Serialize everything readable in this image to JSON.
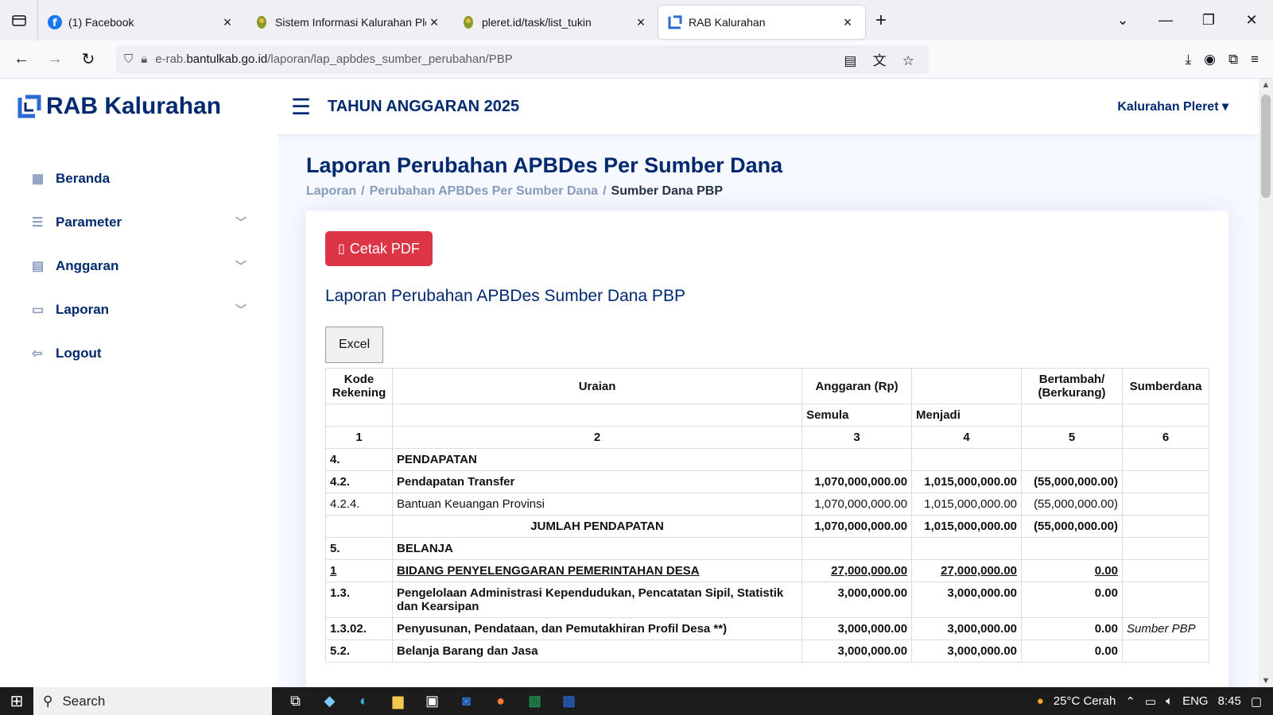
{
  "browser": {
    "tabs": [
      {
        "title": "(1) Facebook",
        "icon": "facebook-icon",
        "active": false
      },
      {
        "title": "Sistem Informasi Kalurahan Pler",
        "icon": "emblem-icon",
        "active": false
      },
      {
        "title": "pleret.id/task/list_tukin",
        "icon": "emblem-icon",
        "active": false
      },
      {
        "title": "RAB Kalurahan",
        "icon": "rab-logo-icon",
        "active": true
      }
    ],
    "url_prefix": "e-rab.",
    "url_domain": "bantulkab.go.id",
    "url_path": "/laporan/lap_apbdes_sumber_perubahan/PBP"
  },
  "header": {
    "logo_text": "RAB Kalurahan",
    "tahun": "TAHUN ANGGARAN 2025",
    "profile": "Kalurahan Pleret"
  },
  "sidebar": {
    "items": [
      {
        "label": "Beranda",
        "icon": "grid-icon"
      },
      {
        "label": "Parameter",
        "icon": "menu-icon"
      },
      {
        "label": "Anggaran",
        "icon": "layout-icon"
      },
      {
        "label": "Laporan",
        "icon": "list-icon"
      },
      {
        "label": "Logout",
        "icon": "logout-icon"
      }
    ]
  },
  "main": {
    "title": "Laporan Perubahan APBDes Per Sumber Dana",
    "breadcrumb": [
      "Laporan",
      "Perubahan APBDes Per Sumber Dana",
      "Sumber Dana PBP"
    ],
    "pdf_button": "Cetak PDF",
    "report_title": "Laporan Perubahan APBDes Sumber Dana PBP",
    "excel_button": "Excel"
  },
  "table": {
    "headers": {
      "kode": "Kode Rekening",
      "uraian": "Uraian",
      "anggaran": "Anggaran (Rp)",
      "bertambah": "Bertambah/ (Berkurang)",
      "sumberdana": "Sumberdana",
      "semula": "Semula",
      "menjadi": "Menjadi",
      "n1": "1",
      "n2": "2",
      "n3": "3",
      "n4": "4",
      "n5": "5",
      "n6": "6"
    },
    "rows": {
      "r1": {
        "kode": "4.",
        "uraian": "PENDAPATAN"
      },
      "r2": {
        "kode": "4.2.",
        "uraian": "Pendapatan Transfer",
        "semula": "1,070,000,000.00",
        "menjadi": "1,015,000,000.00",
        "selisih": "(55,000,000.00)"
      },
      "r3": {
        "kode": "4.2.4.",
        "uraian": "Bantuan Keuangan Provinsi",
        "semula": "1,070,000,000.00",
        "menjadi": "1,015,000,000.00",
        "selisih": "(55,000,000.00)"
      },
      "r4": {
        "uraian": "JUMLAH PENDAPATAN",
        "semula": "1,070,000,000.00",
        "menjadi": "1,015,000,000.00",
        "selisih": "(55,000,000.00)"
      },
      "r5": {
        "kode": "5.",
        "uraian": "BELANJA"
      },
      "r6": {
        "kode": "1",
        "uraian": "BIDANG PENYELENGGARAN PEMERINTAHAN DESA",
        "semula": "27,000,000.00",
        "menjadi": "27,000,000.00",
        "selisih": "0.00"
      },
      "r7": {
        "kode": "1.3.",
        "uraian": "Pengelolaan Administrasi Kependudukan, Pencatatan Sipil, Statistik dan Kearsipan",
        "semula": "3,000,000.00",
        "menjadi": "3,000,000.00",
        "selisih": "0.00"
      },
      "r8": {
        "kode": "1.3.02.",
        "uraian": "Penyusunan, Pendataan, dan Pemutakhiran Profil Desa **)",
        "semula": "3,000,000.00",
        "menjadi": "3,000,000.00",
        "selisih": "0.00",
        "sumber": "Sumber PBP"
      },
      "r9": {
        "kode": "5.2.",
        "uraian": "Belanja Barang dan Jasa",
        "semula": "3,000,000.00",
        "menjadi": "3,000,000.00",
        "selisih": "0.00"
      }
    }
  },
  "taskbar": {
    "search": "Search",
    "weather": "25°C  Cerah",
    "lang": "ENG",
    "time": "8:45"
  }
}
